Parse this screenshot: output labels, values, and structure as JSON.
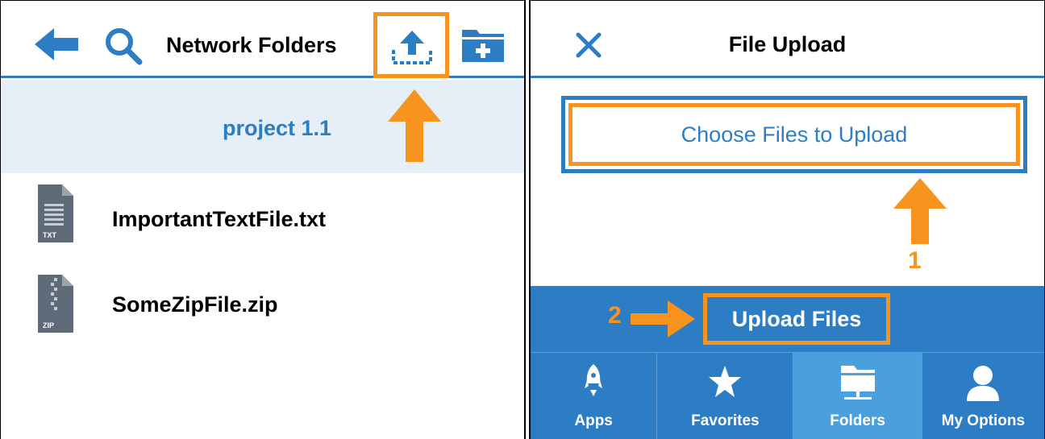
{
  "left": {
    "header": {
      "title": "Network Folders"
    },
    "current_folder": "project 1.1",
    "files": [
      {
        "name": "ImportantTextFile.txt",
        "badge": "TXT"
      },
      {
        "name": "SomeZipFile.zip",
        "badge": "ZIP"
      }
    ],
    "icons": {
      "back": "back-arrow-icon",
      "search": "search-icon",
      "upload": "upload-icon",
      "new_folder": "new-folder-icon"
    }
  },
  "right": {
    "header": {
      "title": "File Upload"
    },
    "choose_button": "Choose Files to Upload",
    "upload_button": "Upload Files",
    "callouts": {
      "step1": "1",
      "step2": "2"
    },
    "nav": [
      {
        "label": "Apps",
        "icon": "rocket-icon"
      },
      {
        "label": "Favorites",
        "icon": "star-icon"
      },
      {
        "label": "Folders",
        "icon": "folder-network-icon",
        "active": true
      },
      {
        "label": "My Options",
        "icon": "user-icon"
      }
    ]
  },
  "colors": {
    "primary_blue": "#2d7dc4",
    "active_blue": "#4aa0dc",
    "highlight_orange": "#f7941d",
    "folder_row_bg": "#e6eef7",
    "file_icon_gray": "#5f6b78"
  }
}
